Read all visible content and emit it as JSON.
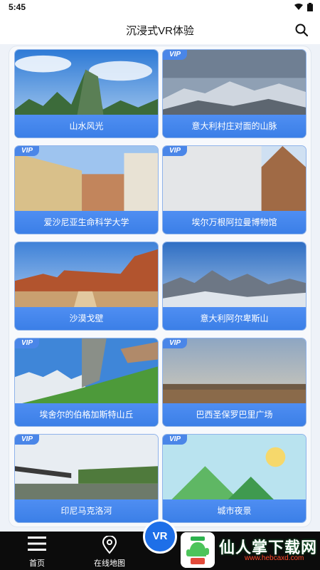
{
  "status": {
    "time": "5:45"
  },
  "header": {
    "title": "沉浸式VR体验"
  },
  "vip_badge": "VIP",
  "cards": [
    {
      "label": "山水风光",
      "vip": false
    },
    {
      "label": "意大利村庄对面的山脉",
      "vip": true
    },
    {
      "label": "爱沙尼亚生命科学大学",
      "vip": true
    },
    {
      "label": "埃尔万根阿拉曼博物馆",
      "vip": true
    },
    {
      "label": "沙漠戈壁",
      "vip": false
    },
    {
      "label": "意大利阿尔卑斯山",
      "vip": false
    },
    {
      "label": "埃舍尔的伯格加斯特山丘",
      "vip": true
    },
    {
      "label": "巴西圣保罗巴里广场",
      "vip": true
    },
    {
      "label": "印尼马克洛河",
      "vip": true
    },
    {
      "label": "城市夜景",
      "vip": true
    }
  ],
  "nav": {
    "home": "首页",
    "map": "在线地图",
    "vr": "VR"
  },
  "watermark": {
    "text": "仙人掌下载网",
    "url": "www.hebcaxd.com"
  }
}
